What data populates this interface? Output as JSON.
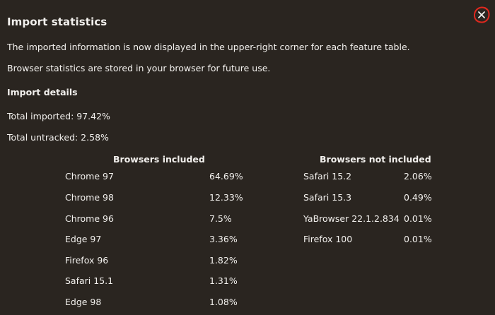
{
  "dialog": {
    "title": "Import statistics",
    "close_icon": "close-icon",
    "close_accent": "#e0281e",
    "paragraph_1": "The imported information is now displayed in the upper-right corner for each feature table.",
    "paragraph_2": "Browser statistics are stored in your browser for future use.",
    "details_heading": "Import details",
    "total_imported": "Total imported: 97.42%",
    "total_untracked": "Total untracked: 2.58%",
    "included": {
      "heading": "Browsers included",
      "rows": [
        {
          "name": "Chrome 97",
          "pct": "64.69%"
        },
        {
          "name": "Chrome 98",
          "pct": "12.33%"
        },
        {
          "name": "Chrome 96",
          "pct": "7.5%"
        },
        {
          "name": "Edge 97",
          "pct": "3.36%"
        },
        {
          "name": "Firefox 96",
          "pct": "1.82%"
        },
        {
          "name": "Safari 15.1",
          "pct": "1.31%"
        },
        {
          "name": "Edge 98",
          "pct": "1.08%"
        }
      ]
    },
    "not_included": {
      "heading": "Browsers not included",
      "rows": [
        {
          "name": "Safari 15.2",
          "pct": "2.06%"
        },
        {
          "name": "Safari 15.3",
          "pct": "0.49%"
        },
        {
          "name": "YaBrowser 22.1.2.834",
          "pct": "0.01%"
        },
        {
          "name": "Firefox 100",
          "pct": "0.01%"
        }
      ]
    }
  }
}
